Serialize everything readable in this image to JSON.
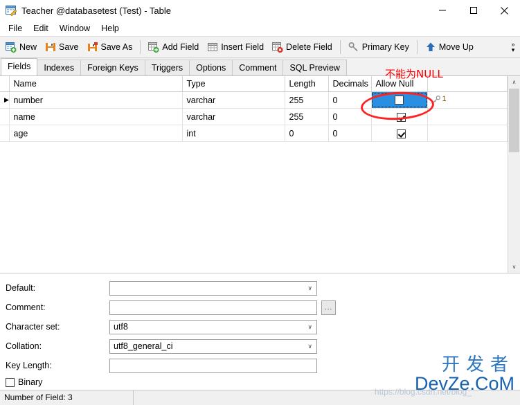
{
  "window": {
    "title": "Teacher @databasetest (Test) - Table",
    "icon": "table-designer-icon",
    "minimize_label": "–",
    "maximize_label": "☐",
    "close_label": "✕"
  },
  "menubar": {
    "items": [
      {
        "label": "File",
        "name": "menu-file"
      },
      {
        "label": "Edit",
        "name": "menu-edit"
      },
      {
        "label": "Window",
        "name": "menu-window"
      },
      {
        "label": "Help",
        "name": "menu-help"
      }
    ]
  },
  "toolbar": {
    "buttons": [
      {
        "label": "New",
        "icon": "new-table-icon"
      },
      {
        "label": "Save",
        "icon": "save-icon"
      },
      {
        "label": "Save As",
        "icon": "save-as-icon"
      },
      {
        "label": "Add Field",
        "icon": "add-field-icon"
      },
      {
        "label": "Insert Field",
        "icon": "insert-field-icon"
      },
      {
        "label": "Delete Field",
        "icon": "delete-field-icon"
      },
      {
        "label": "Primary Key",
        "icon": "primary-key-icon"
      },
      {
        "label": "Move Up",
        "icon": "move-up-icon"
      }
    ],
    "overflow_label": "»"
  },
  "tabs": [
    {
      "label": "Fields",
      "active": true
    },
    {
      "label": "Indexes",
      "active": false
    },
    {
      "label": "Foreign Keys",
      "active": false
    },
    {
      "label": "Triggers",
      "active": false
    },
    {
      "label": "Options",
      "active": false
    },
    {
      "label": "Comment",
      "active": false
    },
    {
      "label": "SQL Preview",
      "active": false
    }
  ],
  "grid": {
    "columns": [
      "Name",
      "Type",
      "Length",
      "Decimals",
      "Allow Null"
    ],
    "rows": [
      {
        "marker": "▶",
        "name": "number",
        "type": "varchar",
        "length": "255",
        "decimals": "0",
        "allow_null": false,
        "selected": true,
        "key_icon": "primary-key-icon",
        "key_order": "1"
      },
      {
        "marker": "",
        "name": "name",
        "type": "varchar",
        "length": "255",
        "decimals": "0",
        "allow_null": true,
        "selected": false,
        "key_icon": "",
        "key_order": ""
      },
      {
        "marker": "",
        "name": "age",
        "type": "int",
        "length": "0",
        "decimals": "0",
        "allow_null": true,
        "selected": false,
        "key_icon": "",
        "key_order": ""
      }
    ],
    "scrollbar": {
      "up_arrow": "∧",
      "down_arrow": "∨"
    }
  },
  "annotation": {
    "red_text": "不能为NULL",
    "red_color": "#ff0000"
  },
  "form": {
    "fields": [
      {
        "label": "Default:",
        "value": "",
        "control": "combobox",
        "name": "default"
      },
      {
        "label": "Comment:",
        "value": "",
        "control": "textbox-with-button",
        "name": "comment"
      },
      {
        "label": "Character set:",
        "value": "utf8",
        "control": "combobox",
        "name": "charset"
      },
      {
        "label": "Collation:",
        "value": "utf8_general_ci",
        "control": "combobox",
        "name": "collation"
      },
      {
        "label": "Key Length:",
        "value": "",
        "control": "textbox",
        "name": "key-length"
      }
    ],
    "ellipsis_button_label": "...",
    "chevron": "∨",
    "binary": {
      "label": "Binary",
      "checked": false
    }
  },
  "statusbar": {
    "field_count": "Number of Field: 3"
  },
  "watermark": {
    "cn": "开发者",
    "en": "DevZe.CoM",
    "url": "https://blog.csdn.net/blog_"
  }
}
